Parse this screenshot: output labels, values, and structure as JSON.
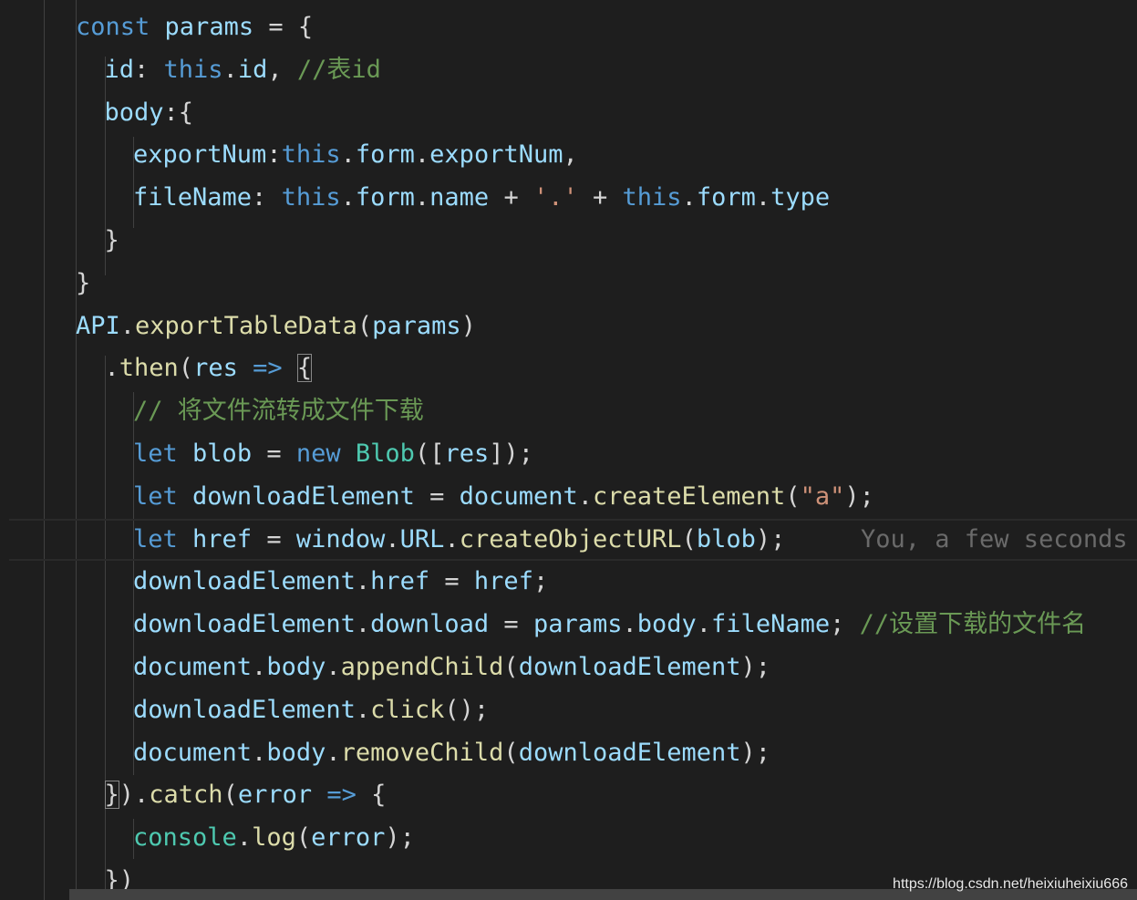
{
  "colors": {
    "background": "#1e1e1e",
    "keyword": "#569cd6",
    "variable": "#9cdcfe",
    "function": "#dcdcaa",
    "class": "#4ec9b0",
    "string": "#ce9178",
    "comment": "#6a9955",
    "punctuation": "#d4d4d4",
    "blame": "#6a6a6a"
  },
  "current_line_index": 12,
  "blame_line_index": 12,
  "blame_text": "You, a few seconds",
  "watermark": "https://blog.csdn.net/heixiuheixiu666",
  "lines": [
    {
      "indent": 0,
      "tokens": [
        [
          "const",
          "k"
        ],
        [
          " ",
          "p"
        ],
        [
          "params",
          "v"
        ],
        [
          " = {",
          "p"
        ]
      ]
    },
    {
      "indent": 1,
      "tokens": [
        [
          "id",
          "v"
        ],
        [
          ": ",
          "p"
        ],
        [
          "this",
          "k"
        ],
        [
          ".",
          "p"
        ],
        [
          "id",
          "v"
        ],
        [
          ", ",
          "p"
        ],
        [
          "//表id",
          "c"
        ]
      ]
    },
    {
      "indent": 1,
      "tokens": [
        [
          "body",
          "v"
        ],
        [
          ":{",
          "p"
        ]
      ]
    },
    {
      "indent": 2,
      "tokens": [
        [
          "exportNum",
          "v"
        ],
        [
          ":",
          "p"
        ],
        [
          "this",
          "k"
        ],
        [
          ".",
          "p"
        ],
        [
          "form",
          "v"
        ],
        [
          ".",
          "p"
        ],
        [
          "exportNum",
          "v"
        ],
        [
          ",",
          "p"
        ]
      ]
    },
    {
      "indent": 2,
      "tokens": [
        [
          "fileName",
          "v"
        ],
        [
          ": ",
          "p"
        ],
        [
          "this",
          "k"
        ],
        [
          ".",
          "p"
        ],
        [
          "form",
          "v"
        ],
        [
          ".",
          "p"
        ],
        [
          "name",
          "v"
        ],
        [
          " + ",
          "p"
        ],
        [
          "'.'",
          "s"
        ],
        [
          " + ",
          "p"
        ],
        [
          "this",
          "k"
        ],
        [
          ".",
          "p"
        ],
        [
          "form",
          "v"
        ],
        [
          ".",
          "p"
        ],
        [
          "type",
          "v"
        ]
      ]
    },
    {
      "indent": 1,
      "tokens": [
        [
          "}",
          "p"
        ]
      ]
    },
    {
      "indent": 0,
      "tokens": [
        [
          "}",
          "p"
        ]
      ]
    },
    {
      "indent": 0,
      "tokens": [
        [
          "API",
          "v"
        ],
        [
          ".",
          "p"
        ],
        [
          "exportTableData",
          "f"
        ],
        [
          "(",
          "p"
        ],
        [
          "params",
          "v"
        ],
        [
          ")",
          "p"
        ]
      ]
    },
    {
      "indent": 1,
      "tokens": [
        [
          ".",
          "p"
        ],
        [
          "then",
          "f"
        ],
        [
          "(",
          "p"
        ],
        [
          "res",
          "v"
        ],
        [
          " ",
          "p"
        ],
        [
          "=>",
          "k"
        ],
        [
          " ",
          "p"
        ],
        [
          "{",
          "b"
        ]
      ]
    },
    {
      "indent": 2,
      "tokens": [
        [
          "// 将文件流转成文件下载",
          "c"
        ]
      ]
    },
    {
      "indent": 2,
      "tokens": [
        [
          "let",
          "k"
        ],
        [
          " ",
          "p"
        ],
        [
          "blob",
          "v"
        ],
        [
          " = ",
          "p"
        ],
        [
          "new",
          "k"
        ],
        [
          " ",
          "p"
        ],
        [
          "Blob",
          "t"
        ],
        [
          "([",
          "p"
        ],
        [
          "res",
          "v"
        ],
        [
          "]);",
          "p"
        ]
      ]
    },
    {
      "indent": 2,
      "tokens": [
        [
          "let",
          "k"
        ],
        [
          " ",
          "p"
        ],
        [
          "downloadElement",
          "v"
        ],
        [
          " = ",
          "p"
        ],
        [
          "document",
          "v"
        ],
        [
          ".",
          "p"
        ],
        [
          "createElement",
          "f"
        ],
        [
          "(",
          "p"
        ],
        [
          "\"a\"",
          "s"
        ],
        [
          ");",
          "p"
        ]
      ]
    },
    {
      "indent": 2,
      "tokens": [
        [
          "let",
          "k"
        ],
        [
          " ",
          "p"
        ],
        [
          "href",
          "v"
        ],
        [
          " = ",
          "p"
        ],
        [
          "window",
          "v"
        ],
        [
          ".",
          "p"
        ],
        [
          "URL",
          "v"
        ],
        [
          ".",
          "p"
        ],
        [
          "createObjectURL",
          "f"
        ],
        [
          "(",
          "p"
        ],
        [
          "blob",
          "v"
        ],
        [
          ");",
          "p"
        ]
      ]
    },
    {
      "indent": 2,
      "tokens": [
        [
          "downloadElement",
          "v"
        ],
        [
          ".",
          "p"
        ],
        [
          "href",
          "v"
        ],
        [
          " = ",
          "p"
        ],
        [
          "href",
          "v"
        ],
        [
          ";",
          "p"
        ]
      ]
    },
    {
      "indent": 2,
      "tokens": [
        [
          "downloadElement",
          "v"
        ],
        [
          ".",
          "p"
        ],
        [
          "download",
          "v"
        ],
        [
          " = ",
          "p"
        ],
        [
          "params",
          "v"
        ],
        [
          ".",
          "p"
        ],
        [
          "body",
          "v"
        ],
        [
          ".",
          "p"
        ],
        [
          "fileName",
          "v"
        ],
        [
          "; ",
          "p"
        ],
        [
          "//设置下载的文件名",
          "c"
        ]
      ]
    },
    {
      "indent": 2,
      "tokens": [
        [
          "document",
          "v"
        ],
        [
          ".",
          "p"
        ],
        [
          "body",
          "v"
        ],
        [
          ".",
          "p"
        ],
        [
          "appendChild",
          "f"
        ],
        [
          "(",
          "p"
        ],
        [
          "downloadElement",
          "v"
        ],
        [
          ");",
          "p"
        ]
      ]
    },
    {
      "indent": 2,
      "tokens": [
        [
          "downloadElement",
          "v"
        ],
        [
          ".",
          "p"
        ],
        [
          "click",
          "f"
        ],
        [
          "();",
          "p"
        ]
      ]
    },
    {
      "indent": 2,
      "tokens": [
        [
          "document",
          "v"
        ],
        [
          ".",
          "p"
        ],
        [
          "body",
          "v"
        ],
        [
          ".",
          "p"
        ],
        [
          "removeChild",
          "f"
        ],
        [
          "(",
          "p"
        ],
        [
          "downloadElement",
          "v"
        ],
        [
          ");",
          "p"
        ]
      ]
    },
    {
      "indent": 1,
      "tokens": [
        [
          "}",
          "b"
        ],
        [
          ").",
          "p"
        ],
        [
          "catch",
          "f"
        ],
        [
          "(",
          "p"
        ],
        [
          "error",
          "v"
        ],
        [
          " ",
          "p"
        ],
        [
          "=>",
          "k"
        ],
        [
          " {",
          "p"
        ]
      ]
    },
    {
      "indent": 2,
      "tokens": [
        [
          "console",
          "t"
        ],
        [
          ".",
          "p"
        ],
        [
          "log",
          "f"
        ],
        [
          "(",
          "p"
        ],
        [
          "error",
          "v"
        ],
        [
          ");",
          "p"
        ]
      ]
    },
    {
      "indent": 1,
      "tokens": [
        [
          "})",
          "p"
        ]
      ]
    }
  ]
}
